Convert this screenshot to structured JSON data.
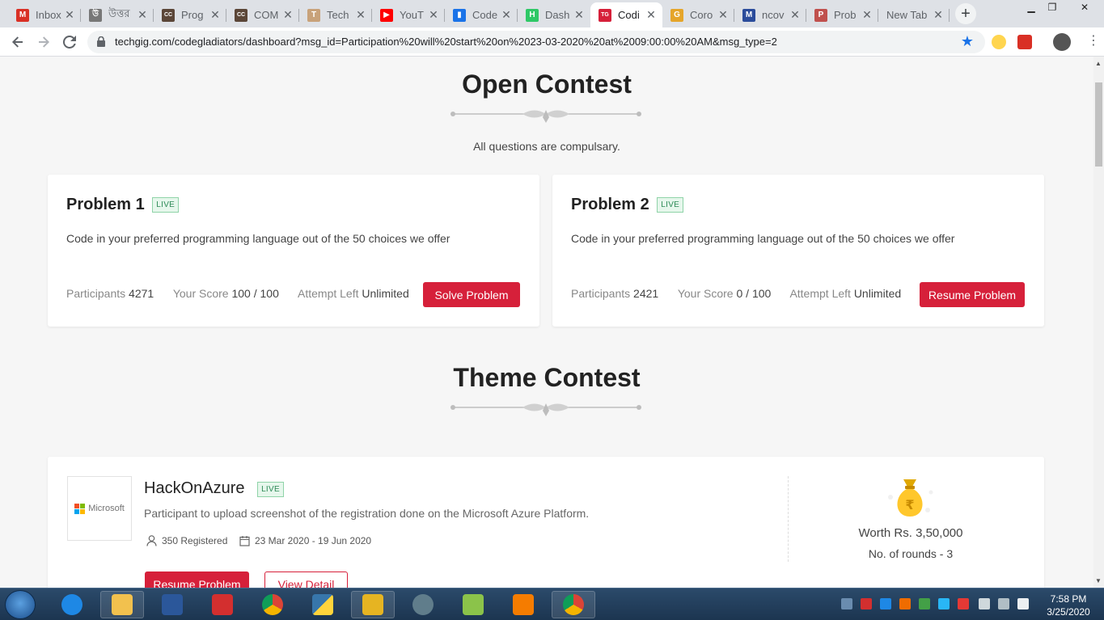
{
  "browser": {
    "tabs": [
      {
        "title": "Inbox",
        "icon": "gmail-icon",
        "color": "#d93025",
        "letter": "M"
      },
      {
        "title": "উত্তর",
        "icon": "bengali-site-icon",
        "color": "#777777",
        "letter": "উ"
      },
      {
        "title": "Prog",
        "icon": "codechef-icon",
        "color": "#5b4638",
        "letter": "CC"
      },
      {
        "title": "COM",
        "icon": "codechef-icon",
        "color": "#5b4638",
        "letter": "CC"
      },
      {
        "title": "Tech",
        "icon": "techgig-figure-icon",
        "color": "#c8a27a",
        "letter": "T"
      },
      {
        "title": "YouT",
        "icon": "youtube-icon",
        "color": "#ff0000",
        "letter": "▶"
      },
      {
        "title": "Code",
        "icon": "bar-chart-icon",
        "color": "#1a73e8",
        "letter": "▮"
      },
      {
        "title": "Dash",
        "icon": "hackerrank-icon",
        "color": "#2ec866",
        "letter": "H"
      },
      {
        "title": "Codi",
        "icon": "techgig-icon",
        "color": "#d6203a",
        "letter": "TG"
      },
      {
        "title": "Coro",
        "icon": "coronavirus-icon",
        "color": "#e5a52a",
        "letter": "G"
      },
      {
        "title": "ncov",
        "icon": "museum-icon",
        "color": "#2b4c9b",
        "letter": "M"
      },
      {
        "title": "Prob",
        "icon": "presentation-icon",
        "color": "#c0504d",
        "letter": "P"
      },
      {
        "title": "New Tab",
        "icon": "",
        "color": "",
        "letter": ""
      }
    ],
    "url": "techgig.com/codegladiators/dashboard?msg_id=Participation%20will%20start%20on%2023-03-2020%20at%2009:00:00%20AM&msg_type=2"
  },
  "open_contest": {
    "title": "Open Contest",
    "subtitle": "All questions are compulsary.",
    "problems": [
      {
        "title": "Problem 1",
        "badge": "LIVE",
        "desc": "Code in your preferred programming language out of the 50 choices we offer",
        "participants_label": "Participants",
        "participants": "4271",
        "score_label": "Your Score",
        "score": "100 / 100",
        "attempt_label": "Attempt Left",
        "attempt": "Unlimited",
        "button": "Solve Problem"
      },
      {
        "title": "Problem 2",
        "badge": "LIVE",
        "desc": "Code in your preferred programming language out of the 50 choices we offer",
        "participants_label": "Participants",
        "participants": "2421",
        "score_label": "Your Score",
        "score": "0 / 100",
        "attempt_label": "Attempt Left",
        "attempt": "Unlimited",
        "button": "Resume Problem"
      }
    ]
  },
  "theme_contest": {
    "title": "Theme Contest",
    "item": {
      "logo_text": "Microsoft",
      "name": "HackOnAzure",
      "badge": "LIVE",
      "desc": "Participant to upload screenshot of the registration done on the Microsoft Azure Platform.",
      "registered": "350 Registered",
      "dates": "23 Mar 2020 - 19 Jun 2020",
      "worth": "Worth Rs. 3,50,000",
      "rounds": "No. of rounds - 3",
      "resume_button": "Resume Problem",
      "detail_button": "View Detail"
    }
  },
  "taskbar": {
    "time": "7:58 PM",
    "date": "3/25/2020"
  },
  "colors": {
    "accent": "#d6203a",
    "live_green": "#2e8b57"
  }
}
